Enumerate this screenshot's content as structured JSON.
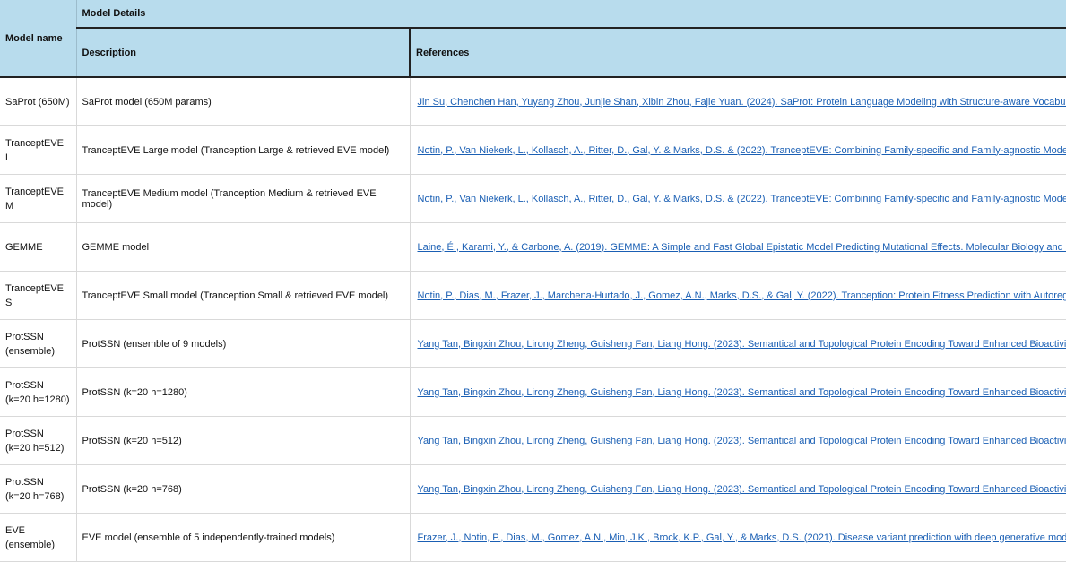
{
  "header": {
    "model_name": "Model name",
    "group": "Model Details",
    "description": "Description",
    "references": "References"
  },
  "rows": [
    {
      "name": "SaProt (650M)",
      "description": "SaProt model (650M params)",
      "reference": "Jin Su, Chenchen Han, Yuyang Zhou, Junjie Shan, Xibin Zhou, Fajie Yuan. (2024). SaProt: Protein Language Modeling with Structure-aware Vocabulary"
    },
    {
      "name": "TranceptEVE L",
      "description": "TranceptEVE Large model (Tranception Large & retrieved EVE model)",
      "reference": "Notin, P., Van Niekerk, L., Kollasch, A., Ritter, D., Gal, Y. & Marks, D.S. & (2022). TranceptEVE: Combining Family-specific and Family-agnostic Models of"
    },
    {
      "name": "TranceptEVE M",
      "description": "TranceptEVE Medium model (Tranception Medium & retrieved EVE model)",
      "reference": "Notin, P., Van Niekerk, L., Kollasch, A., Ritter, D., Gal, Y. & Marks, D.S. & (2022). TranceptEVE: Combining Family-specific and Family-agnostic Models of"
    },
    {
      "name": "GEMME",
      "description": "GEMME model",
      "reference": "Laine, É., Karami, Y., & Carbone, A. (2019). GEMME: A Simple and Fast Global Epistatic Model Predicting Mutational Effects. Molecular Biology and Evolution"
    },
    {
      "name": "TranceptEVE S",
      "description": "TranceptEVE Small model (Tranception Small & retrieved EVE model)",
      "reference": "Notin, P., Dias, M., Frazer, J., Marchena-Hurtado, J., Gomez, A.N., Marks, D.S., & Gal, Y. (2022). Tranception: Protein Fitness Prediction with Autoregressive"
    },
    {
      "name": "ProtSSN (ensemble)",
      "description": "ProtSSN (ensemble of 9 models)",
      "reference": "Yang Tan, Bingxin Zhou, Lirong Zheng, Guisheng Fan, Liang Hong. (2023). Semantical and Topological Protein Encoding Toward Enhanced Bioactivity"
    },
    {
      "name": "ProtSSN (k=20 h=1280)",
      "description": "ProtSSN (k=20 h=1280)",
      "reference": "Yang Tan, Bingxin Zhou, Lirong Zheng, Guisheng Fan, Liang Hong. (2023). Semantical and Topological Protein Encoding Toward Enhanced Bioactivity"
    },
    {
      "name": "ProtSSN (k=20 h=512)",
      "description": "ProtSSN (k=20 h=512)",
      "reference": "Yang Tan, Bingxin Zhou, Lirong Zheng, Guisheng Fan, Liang Hong. (2023). Semantical and Topological Protein Encoding Toward Enhanced Bioactivity"
    },
    {
      "name": "ProtSSN (k=20 h=768)",
      "description": "ProtSSN (k=20 h=768)",
      "reference": "Yang Tan, Bingxin Zhou, Lirong Zheng, Guisheng Fan, Liang Hong. (2023). Semantical and Topological Protein Encoding Toward Enhanced Bioactivity"
    },
    {
      "name": "EVE (ensemble)",
      "description": "EVE model (ensemble of 5 independently-trained models)",
      "reference": "Frazer, J., Notin, P., Dias, M., Gomez, A.N., Min, J.K., Brock, K.P., Gal, Y., & Marks, D.S. (2021). Disease variant prediction with deep generative models"
    }
  ]
}
